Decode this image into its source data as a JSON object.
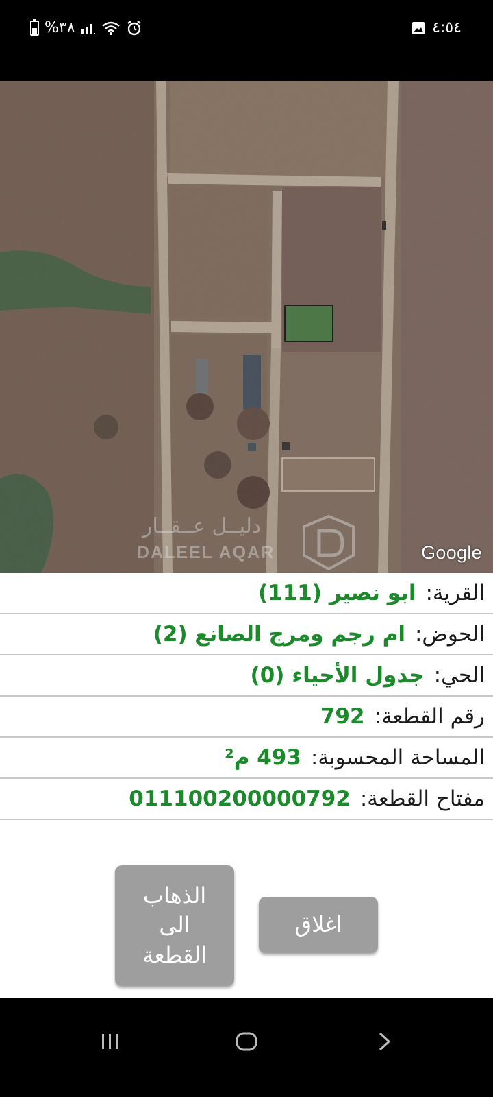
{
  "status_bar": {
    "time": "٤:٥٤",
    "battery": "%٣٨",
    "icons": [
      "gallery-icon",
      "alarm-icon",
      "wifi-icon",
      "signal-icon",
      "battery-icon"
    ]
  },
  "map": {
    "attribution": "Google",
    "watermark_ar": "دليــل عــقــار",
    "watermark_en": "DALEEL AQAR",
    "highlight_color": "#2f8a3c"
  },
  "info": {
    "rows": [
      {
        "label": "القرية:",
        "value": "ابو نصير (111)"
      },
      {
        "label": "الحوض:",
        "value": "ام رجم ومرج الصانع (2)"
      },
      {
        "label": "الحي:",
        "value": "جدول الأحياء (0)"
      },
      {
        "label": "رقم القطعة:",
        "value": "792"
      },
      {
        "label": "المساحة المحسوبة:",
        "value": "493 م²"
      },
      {
        "label": "مفتاح القطعة:",
        "value": "011100200000792"
      }
    ],
    "value_color": "#1b8a2b"
  },
  "buttons": {
    "close_label": "اغلاق",
    "go_label": "الذهاب الى القطعة"
  },
  "navbar": {
    "icons": [
      "recent-apps-icon",
      "home-icon",
      "back-icon"
    ]
  }
}
